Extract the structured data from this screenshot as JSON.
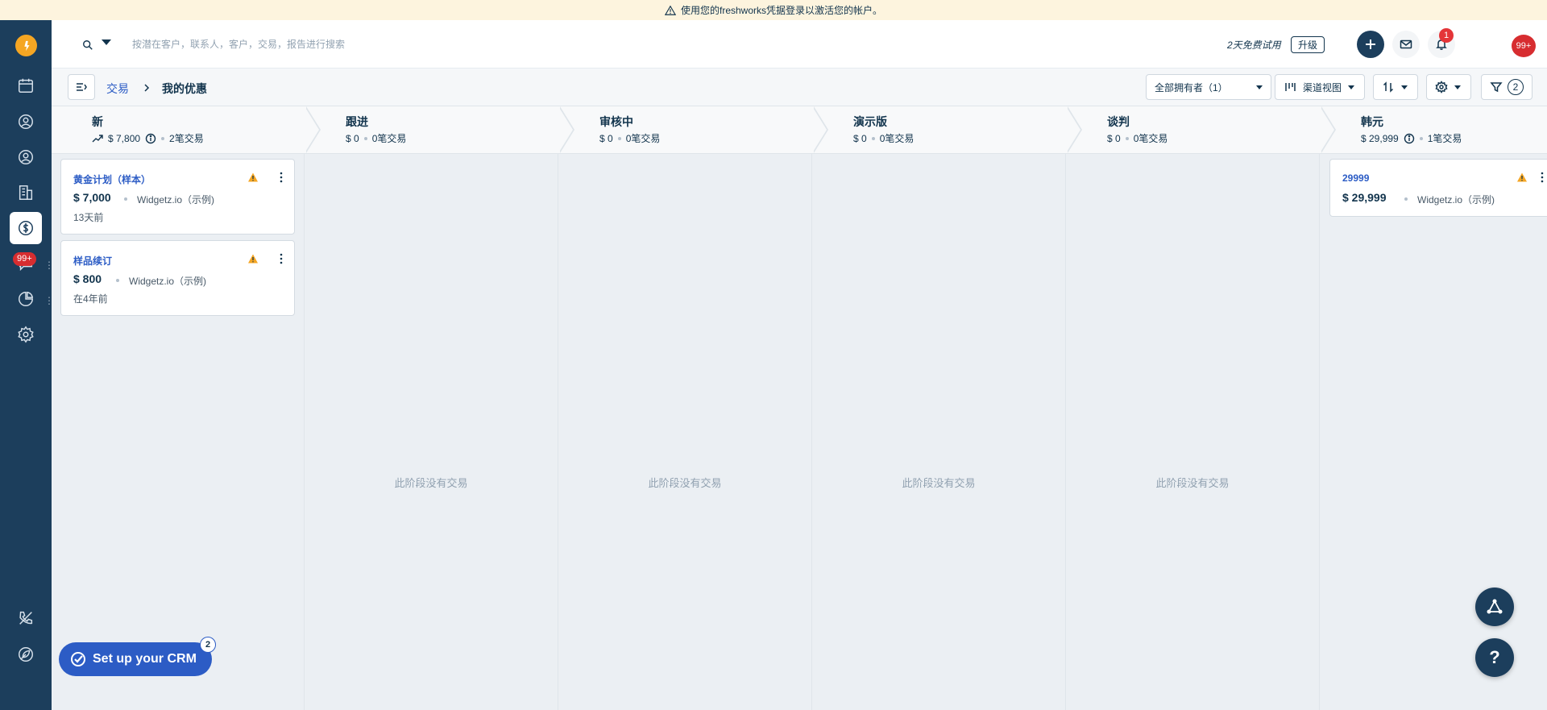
{
  "banner": {
    "text": "使用您的freshworks凭据登录以激活您的帐户。"
  },
  "sidebar": {
    "badge": "99+",
    "items": [
      "calendar-icon",
      "contacts-icon",
      "user-icon",
      "accounts-icon",
      "deals-icon",
      "conversations-icon",
      "reports-icon",
      "settings-icon",
      "phone-icon",
      "leaf-icon"
    ]
  },
  "header": {
    "search_placeholder": "按潜在客户，联系人，客户，交易，报告进行搜索",
    "trial_text": "2天免费试用",
    "upgrade_label": "升级",
    "notification_count": "1",
    "alert_count": "99+"
  },
  "toolbar": {
    "breadcrumb_parent": "交易",
    "breadcrumb_current": "我的优惠",
    "owner_filter": "全部拥有者（1）",
    "view_label": "渠道视图",
    "filter_count": "2"
  },
  "stages": [
    {
      "name": "新",
      "amount": "$ 7,800",
      "count": "2笔交易",
      "trend": true,
      "info": true
    },
    {
      "name": "跟进",
      "amount": "$ 0",
      "count": "0笔交易"
    },
    {
      "name": "审核中",
      "amount": "$ 0",
      "count": "0笔交易"
    },
    {
      "name": "演示版",
      "amount": "$ 0",
      "count": "0笔交易"
    },
    {
      "name": "谈判",
      "amount": "$ 0",
      "count": "0笔交易"
    },
    {
      "name": "韩元",
      "amount": "$ 29,999",
      "count": "1笔交易",
      "info": true
    }
  ],
  "empty_message": "此阶段没有交易",
  "deals": [
    {
      "title": "黄金计划（样本）",
      "amount": "$ 7,000",
      "company": "Widgetz.io（示例)",
      "time": "13天前"
    },
    {
      "title": "样品续订",
      "amount": "$ 800",
      "company": "Widgetz.io（示例)",
      "time": "在4年前"
    },
    {
      "title": "29999",
      "amount": "$ 29,999",
      "company": "Widgetz.io（示例)"
    }
  ],
  "setup": {
    "label": "Set up your CRM",
    "badge": "2"
  },
  "help_label": "?",
  "colors": {
    "sidebar": "#1c3e5c",
    "link": "#2c5cc5",
    "badge": "#d72d30",
    "banner": "#fdf4de"
  }
}
